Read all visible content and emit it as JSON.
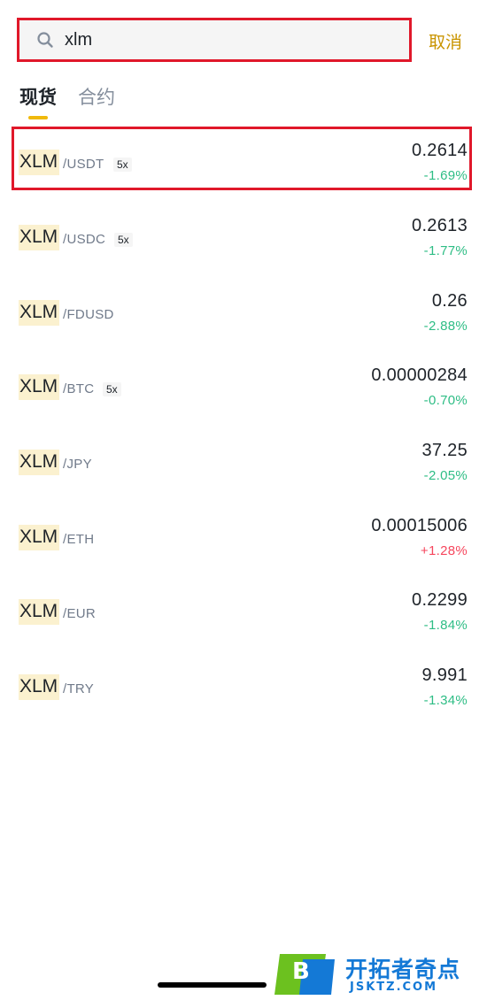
{
  "search": {
    "value": "xlm",
    "cancel_label": "取消"
  },
  "tabs": [
    {
      "label": "现货",
      "active": true
    },
    {
      "label": "合约",
      "active": false
    }
  ],
  "markets": [
    {
      "base": "XLM",
      "quote": "/USDT",
      "leverage": "5x",
      "price": "0.2614",
      "change": "-1.69%",
      "direction": "down"
    },
    {
      "base": "XLM",
      "quote": "/USDC",
      "leverage": "5x",
      "price": "0.2613",
      "change": "-1.77%",
      "direction": "down"
    },
    {
      "base": "XLM",
      "quote": "/FDUSD",
      "leverage": "",
      "price": "0.26",
      "change": "-2.88%",
      "direction": "down"
    },
    {
      "base": "XLM",
      "quote": "/BTC",
      "leverage": "5x",
      "price": "0.00000284",
      "change": "-0.70%",
      "direction": "down"
    },
    {
      "base": "XLM",
      "quote": "/JPY",
      "leverage": "",
      "price": "37.25",
      "change": "-2.05%",
      "direction": "down"
    },
    {
      "base": "XLM",
      "quote": "/ETH",
      "leverage": "",
      "price": "0.00015006",
      "change": "+1.28%",
      "direction": "up"
    },
    {
      "base": "XLM",
      "quote": "/EUR",
      "leverage": "",
      "price": "0.2299",
      "change": "-1.84%",
      "direction": "down"
    },
    {
      "base": "XLM",
      "quote": "/TRY",
      "leverage": "",
      "price": "9.991",
      "change": "-1.34%",
      "direction": "down"
    }
  ],
  "watermark": {
    "logo_letter": "B",
    "title": "开拓者奇点",
    "subtitle": "JSKTZ.COM"
  },
  "colors": {
    "accent": "#f0b90b",
    "cancel": "#c99400",
    "negative": "#2ebd85",
    "positive": "#f6465d",
    "highlight_box": "#e0182a"
  }
}
